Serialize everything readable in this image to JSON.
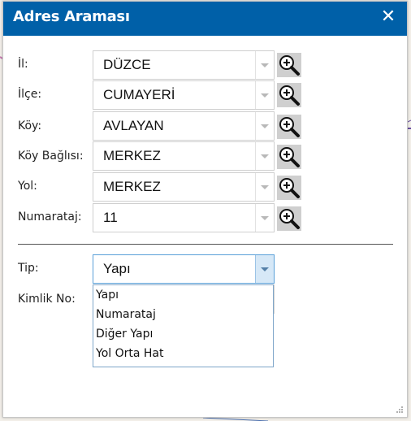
{
  "window": {
    "title": "Adres Araması"
  },
  "fields": [
    {
      "label": "İl:",
      "value": "DÜZCE"
    },
    {
      "label": "İlçe:",
      "value": "CUMAYERİ"
    },
    {
      "label": "Köy:",
      "value": "AVLAYAN"
    },
    {
      "label": "Köy Bağlısı:",
      "value": "MERKEZ"
    },
    {
      "label": "Yol:",
      "value": "MERKEZ"
    },
    {
      "label": "Numarataj:",
      "value": "11"
    }
  ],
  "tip": {
    "label": "Tip:",
    "value": "Yapı"
  },
  "kimlik": {
    "label": "Kimlik No:",
    "value": ""
  },
  "dropdown_options": [
    "Yapı",
    "Numarataj",
    "Diğer Yapı",
    "Yol Orta Hat"
  ],
  "colors": {
    "titlebar": "#0060a8",
    "zoom_button": "#cfcfcf",
    "active_border": "#5aa0d8"
  },
  "icons": {
    "close": "close-icon",
    "zoom": "zoom-in-icon",
    "dropdown": "chevron-down-icon"
  }
}
